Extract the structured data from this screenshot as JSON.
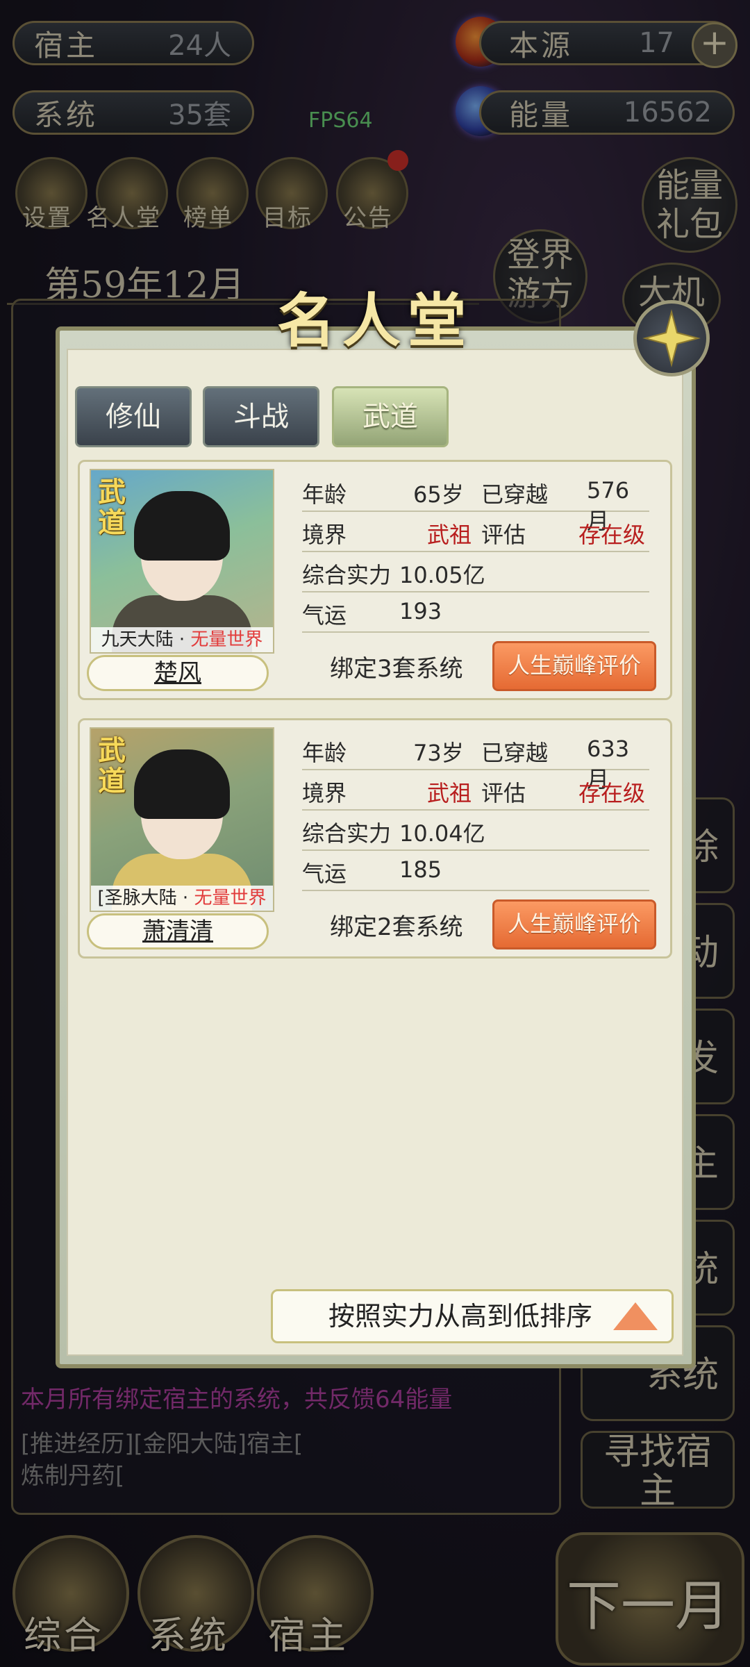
{
  "hud": {
    "host_label": "宿主",
    "host_value": "24人",
    "source_label": "本源",
    "source_value": "17",
    "system_label": "系统",
    "system_value": "35套",
    "energy_label": "能量",
    "energy_value": "16562",
    "fps": "FPS64"
  },
  "menu": [
    {
      "label": "设置"
    },
    {
      "label": "名人堂"
    },
    {
      "label": "榜单"
    },
    {
      "label": "目标"
    },
    {
      "label": "公告"
    }
  ],
  "right_buttons": {
    "energy_pack": "能量礼包",
    "travel": "登界游方",
    "chance": "大机"
  },
  "date": "第59年12月",
  "log": [
    {
      "text": "本月所有绑定宿主的系统，共反馈64能量",
      "color": "#b03fa0"
    },
    {
      "text": "[推进经历][金阳大陆]宿主[",
      "color": "#8a8a8a"
    },
    {
      "text": "炼制丹药[",
      "color": "#8a8a8a"
    }
  ],
  "side_tabs": [
    "除",
    "动",
    "发",
    "主",
    "统",
    "系统"
  ],
  "find_host": "寻找宿主",
  "bottom_nav": {
    "overall": "综合",
    "system": "系统",
    "host": "宿主",
    "next_month": "下一月"
  },
  "modal": {
    "title": "名人堂",
    "tabs": [
      {
        "label": "修仙",
        "active": false
      },
      {
        "label": "斗战",
        "active": false
      },
      {
        "label": "武道",
        "active": true
      }
    ],
    "cards": [
      {
        "badge": "武道",
        "world": "九天大陆 · ",
        "world_tag": "无量世界",
        "name": "楚风",
        "age_label": "年龄",
        "age": "65岁",
        "travel_label": "已穿越",
        "travel": "576月",
        "realm_label": "境界",
        "realm": "武祖",
        "assess_label": "评估",
        "assess": "存在级",
        "power_label": "综合实力",
        "power": "10.05亿",
        "luck_label": "气运",
        "luck": "193",
        "bind": "绑定3套系统",
        "eval_button": "人生巅峰评价"
      },
      {
        "badge": "武道",
        "world": "[圣脉大陆 · ",
        "world_tag": "无量世界",
        "name": "萧清清",
        "age_label": "年龄",
        "age": "73岁",
        "travel_label": "已穿越",
        "travel": "633月",
        "realm_label": "境界",
        "realm": "武祖",
        "assess_label": "评估",
        "assess": "存在级",
        "power_label": "综合实力",
        "power": "10.04亿",
        "luck_label": "气运",
        "luck": "185",
        "bind": "绑定2套系统",
        "eval_button": "人生巅峰评价"
      }
    ],
    "sort_label": "按照实力从高到低排序"
  }
}
